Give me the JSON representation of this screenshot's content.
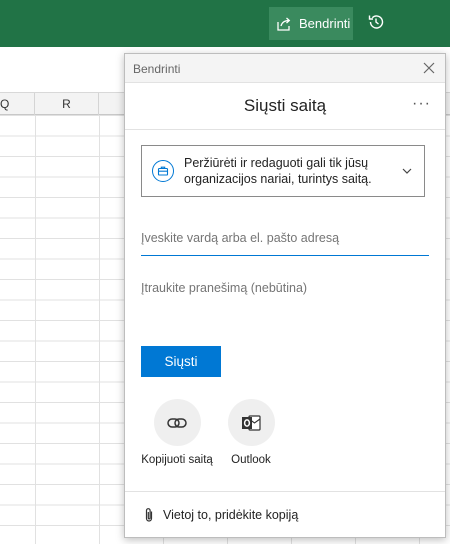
{
  "ribbon": {
    "share_label": "Bendrinti",
    "share_icon": "share-icon",
    "history_icon": "history-icon",
    "color": "#217346"
  },
  "sheet": {
    "columns": [
      "Q",
      "R"
    ]
  },
  "dialog": {
    "caption": "Bendrinti",
    "heading": "Siųsti saitą",
    "more_label": "···",
    "permission": {
      "icon": "briefcase-icon",
      "text": "Peržiūrėti ir redaguoti gali tik jūsų organizacijos nariai, turintys saitą."
    },
    "recipient_placeholder": "Įveskite vardą arba el. pašto adresą",
    "message_placeholder": "Įtraukite pranešimą (nebūtina)",
    "send_label": "Siųsti",
    "options": [
      {
        "label": "Kopijuoti saitą",
        "icon": "link-icon"
      },
      {
        "label": "Outlook",
        "icon": "outlook-icon"
      }
    ],
    "footer_label": "Vietoj to, pridėkite kopiją",
    "accent": "#0078d4"
  }
}
